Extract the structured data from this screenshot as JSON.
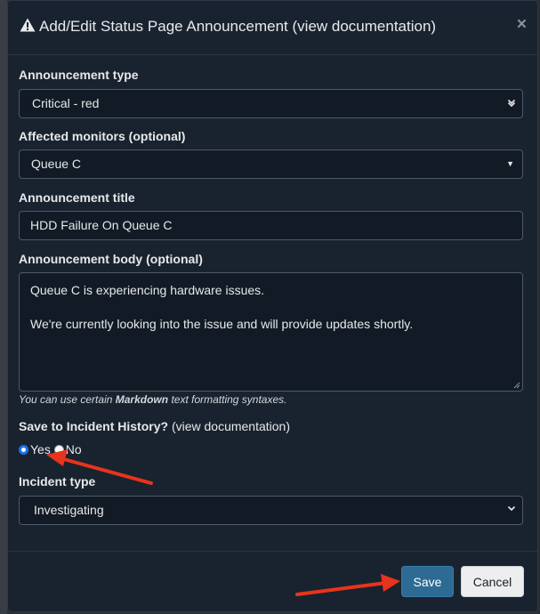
{
  "modal": {
    "title_main": "Add/Edit Status Page Announcement",
    "title_link": "(view documentation)",
    "close_glyph": "×"
  },
  "form": {
    "announcement_type": {
      "label": "Announcement type",
      "value": "Critical - red"
    },
    "affected_monitors": {
      "label": "Affected monitors (optional)",
      "value": "Queue C"
    },
    "announcement_title": {
      "label": "Announcement title",
      "value": "HDD Failure On Queue C"
    },
    "announcement_body": {
      "label": "Announcement body (optional)",
      "line1": "Queue C is experiencing hardware issues.",
      "line2": "We're currently looking into the issue and will provide updates shortly."
    },
    "help": {
      "prefix": "You can use certain",
      "bold": "Markdown",
      "suffix": "text formatting syntaxes."
    },
    "incident_history": {
      "label": "Save to Incident History?",
      "link": "(view documentation)",
      "yes": "Yes",
      "no": "No",
      "selected": "Yes"
    },
    "incident_type": {
      "label": "Incident type",
      "value": "Investigating"
    }
  },
  "footer": {
    "save_label": "Save",
    "cancel_label": "Cancel"
  },
  "colors": {
    "modal_bg": "#19232f",
    "accent": "#2d6b94",
    "annotation_arrow": "#e8341c"
  },
  "icons": {
    "title_icon": "warning-icon",
    "close": "close-icon",
    "select_chevron": "chevron-icon"
  }
}
